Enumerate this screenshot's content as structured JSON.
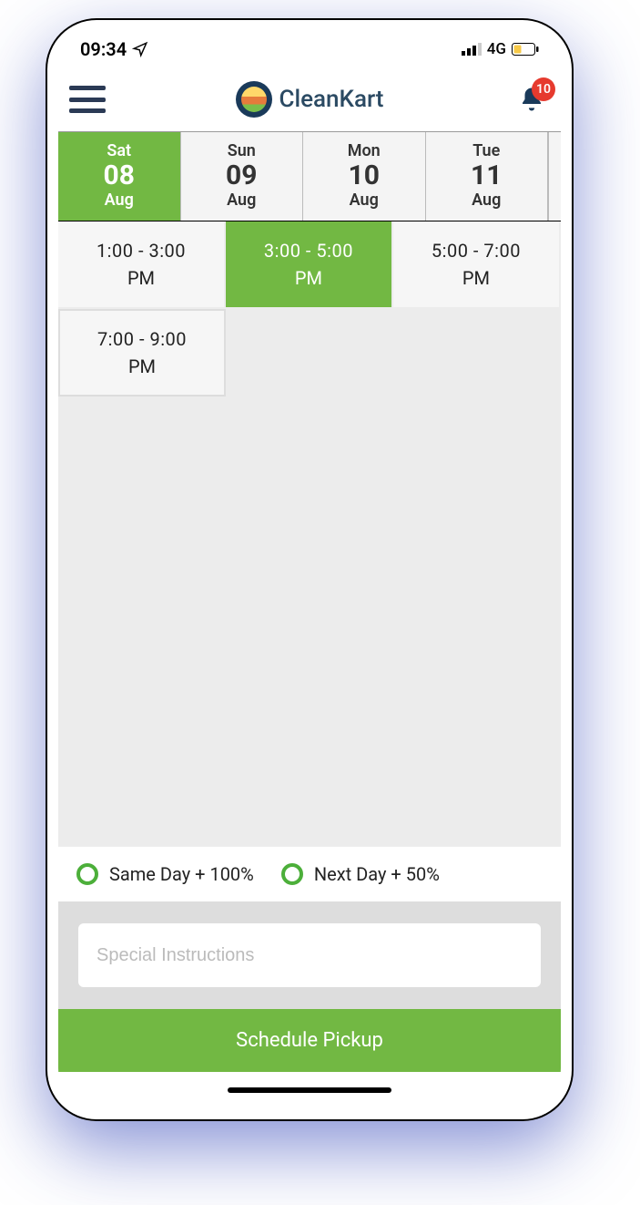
{
  "status": {
    "time": "09:34",
    "network": "4G"
  },
  "header": {
    "brand": "CleanKart",
    "badge": "10"
  },
  "dates": [
    {
      "dow": "Sat",
      "num": "08",
      "mon": "Aug",
      "active": true
    },
    {
      "dow": "Sun",
      "num": "09",
      "mon": "Aug",
      "active": false
    },
    {
      "dow": "Mon",
      "num": "10",
      "mon": "Aug",
      "active": false
    },
    {
      "dow": "Tue",
      "num": "11",
      "mon": "Aug",
      "active": false
    }
  ],
  "slots": [
    {
      "range": "1:00  - 3:00",
      "ampm": "PM",
      "state": "neutral"
    },
    {
      "range": "3:00  - 5:00",
      "ampm": "PM",
      "state": "selected"
    },
    {
      "range": "5:00  - 7:00",
      "ampm": "PM",
      "state": "neutral"
    },
    {
      "range": "7:00  - 9:00",
      "ampm": "PM",
      "state": "boxed"
    }
  ],
  "options": {
    "same_day": "Same Day + 100%",
    "next_day": "Next Day + 50%"
  },
  "instructions": {
    "placeholder": "Special Instructions"
  },
  "cta": "Schedule Pickup"
}
